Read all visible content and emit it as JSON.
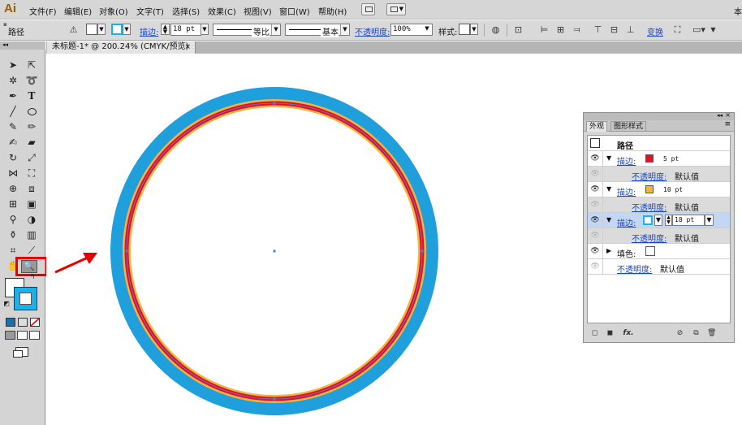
{
  "app": {
    "logo": "Ai"
  },
  "menubar": {
    "items": [
      "文件(F)",
      "编辑(E)",
      "对象(O)",
      "文字(T)",
      "选择(S)",
      "效果(C)",
      "视图(V)",
      "窗口(W)",
      "帮助(H)"
    ],
    "right_text": "本"
  },
  "controlbar": {
    "selection_label": "路径",
    "stroke_label": "描边:",
    "stroke_weight": "18 pt",
    "profile_label": "等比",
    "brush_label": "基本",
    "opacity_label": "不透明度:",
    "opacity_value": "100%",
    "style_label": "样式:",
    "transform_label": "变换"
  },
  "document": {
    "tab_title": "未标题-1* @ 200.24% (CMYK/预览)",
    "close_glyph": "×"
  },
  "artwork": {
    "rings": [
      {
        "name": "outer-blue-stroke",
        "color": "#1f9fdc"
      },
      {
        "name": "orange-stroke",
        "color": "#f4b63a"
      },
      {
        "name": "red-stroke",
        "color": "#e2102f"
      }
    ]
  },
  "appearance_panel": {
    "tabs": [
      "外观",
      "图形样式"
    ],
    "header_title": "路径",
    "rows": [
      {
        "type": "stroke",
        "label": "描边:",
        "color": "#e8101e",
        "value": "5 pt"
      },
      {
        "type": "opacity",
        "label": "不透明度:",
        "value": "默认值"
      },
      {
        "type": "stroke",
        "label": "描边:",
        "color": "#f4b63a",
        "value": "10 pt"
      },
      {
        "type": "opacity",
        "label": "不透明度:",
        "value": "默认值"
      },
      {
        "type": "stroke",
        "label": "描边:",
        "color": "#1eb0ea",
        "value": "18 pt",
        "selected": true
      },
      {
        "type": "opacity",
        "label": "不透明度:",
        "value": "默认值"
      },
      {
        "type": "fill",
        "label": "填色:",
        "color": "#ffffff"
      },
      {
        "type": "opacity",
        "label": "不透明度:",
        "value": "默认值"
      }
    ],
    "footer_fx": "fx."
  },
  "toolbox": {
    "active_tool": "zoom-tool",
    "fill_color": "#ffffff",
    "stroke_color": "#1eb0ea"
  },
  "colors": {
    "highlight_red": "#e60000",
    "link_blue": "#1a47c9",
    "selection_blue": "#c3d6f3"
  }
}
